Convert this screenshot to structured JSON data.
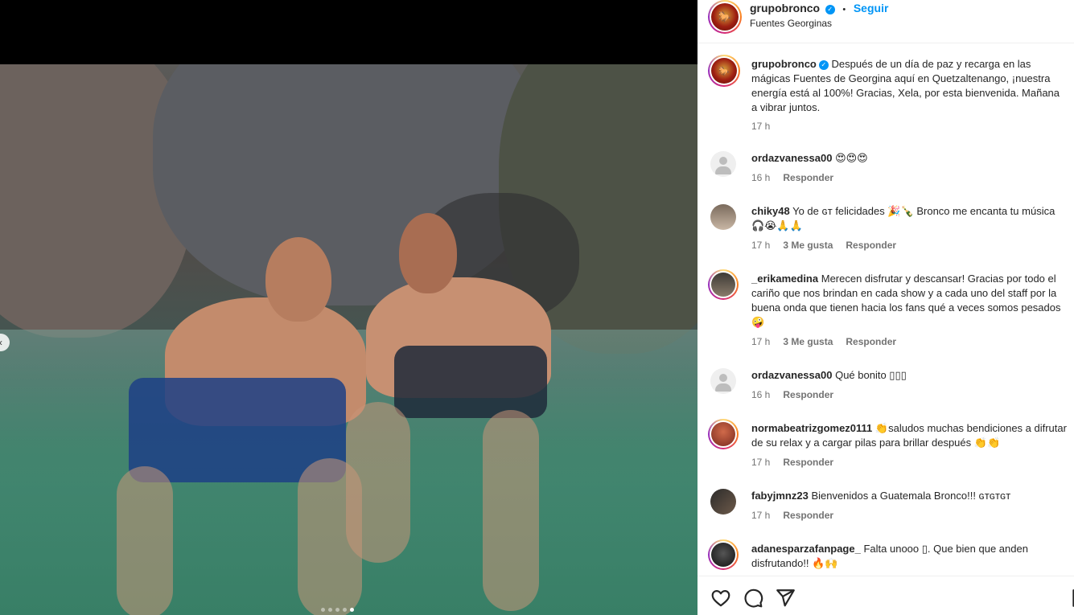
{
  "post": {
    "username": "grupobronco",
    "follow_label": "Seguir",
    "separator": "•",
    "location": "Fuentes Georginas",
    "verified_icon": "verified-badge-icon",
    "caption": "Después de un día de paz y recarga en las mágicas Fuentes de Georgina aquí en Quetzaltenango, ¡nuestra energía está al 100%! Gracias, Xela, por esta bienvenida. Mañana a vibrar juntos.",
    "caption_time": "17 h"
  },
  "carousel": {
    "total": 5,
    "active_index": 5
  },
  "comments": [
    {
      "user": "ordazvanessa00",
      "text": "😍😍😍",
      "time": "16 h",
      "likes": "",
      "reply": "Responder"
    },
    {
      "user": "chiky48",
      "text": "Yo de ɢᴛ felicidades 🎉🍾 Bronco me encanta tu música 🎧😭🙏🙏",
      "time": "17 h",
      "likes": "3 Me gusta",
      "reply": "Responder"
    },
    {
      "user": "_erikamedina",
      "text": "Merecen disfrutar y descansar! Gracias por todo el cariño que nos brindan en cada show y a cada uno del staff por la buena onda que tienen hacia los fans qué a veces somos pesados 🤪",
      "time": "17 h",
      "likes": "3 Me gusta",
      "reply": "Responder"
    },
    {
      "user": "ordazvanessa00",
      "text": "Qué bonito ▯▯▯",
      "time": "16 h",
      "likes": "",
      "reply": "Responder"
    },
    {
      "user": "normabeatrizgomez0111",
      "text": "👏saludos muchas bendiciones a difrutar de su relax y a cargar pilas para brillar después 👏👏",
      "time": "17 h",
      "likes": "",
      "reply": "Responder"
    },
    {
      "user": "fabyjmnz23",
      "text": "Bienvenidos a Guatemala Bronco!!! ɢᴛɢᴛɢᴛ",
      "time": "17 h",
      "likes": "",
      "reply": "Responder"
    },
    {
      "user": "adanesparzafanpage_",
      "text": "Falta unooo ▯. Que bien que anden disfrutando!! 🔥🙌",
      "time": "",
      "likes": "",
      "reply": ""
    }
  ],
  "actions": {
    "like_icon": "heart-icon",
    "comment_icon": "comment-icon",
    "share_icon": "send-icon",
    "save_icon": "bookmark-icon"
  },
  "colors": {
    "accent": "#0095f6",
    "secondary_text": "#737373",
    "border": "#efefef"
  }
}
